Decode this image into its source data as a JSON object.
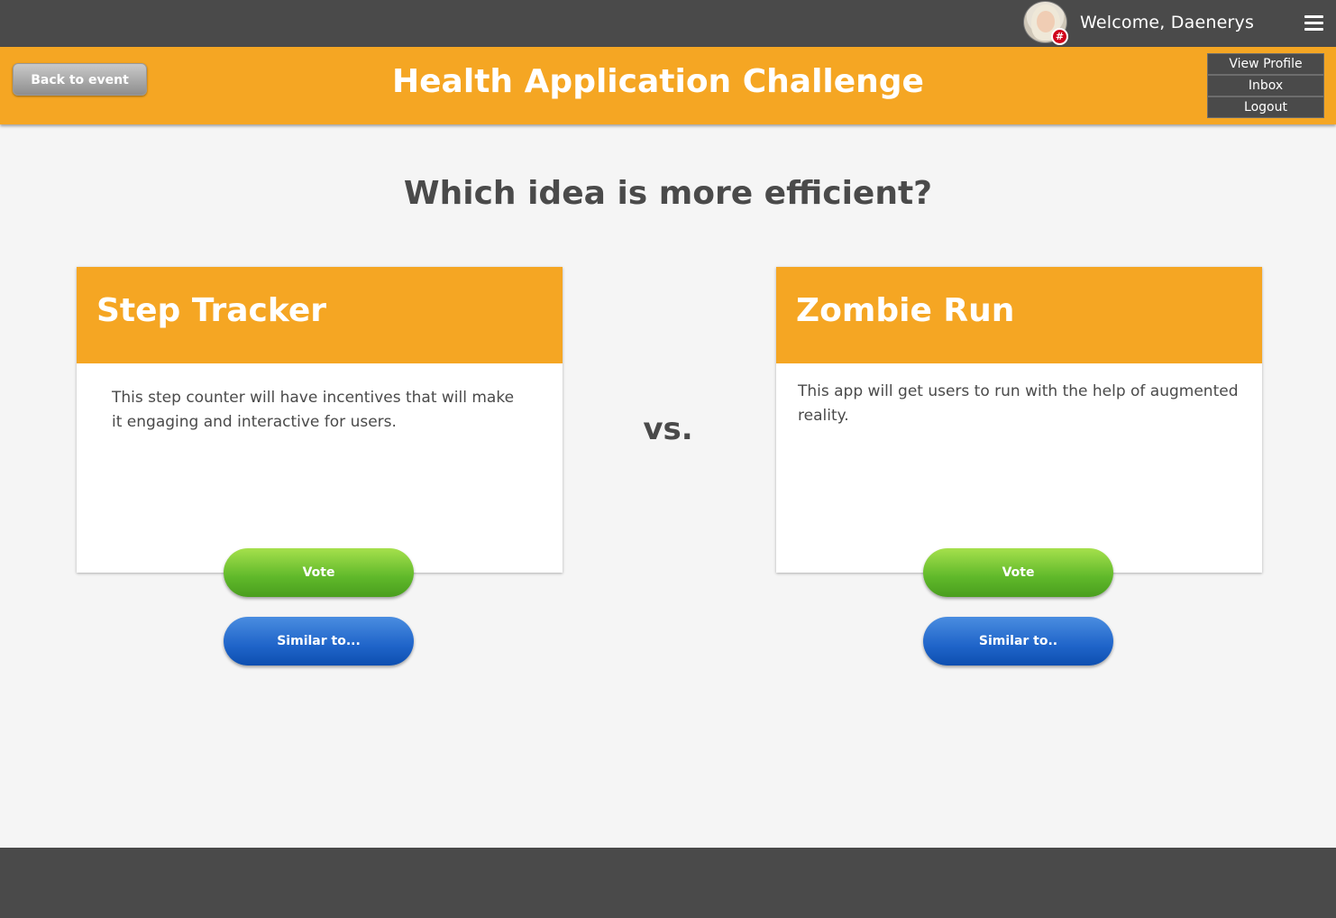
{
  "topbar": {
    "welcome": "Welcome, Daenerys",
    "badge": "#",
    "menu_icon": "hamburger-icon"
  },
  "header": {
    "back_label": "Back to event",
    "title": "Health Application Challenge",
    "dropdown": [
      "View Profile",
      "Inbox",
      "Logout"
    ]
  },
  "main": {
    "question": "Which idea is more efficient?",
    "vs": "vs.",
    "ideas": [
      {
        "title": "Step Tracker",
        "description": "This step counter will have incentives that will make it engaging and interactive for users.",
        "vote_label": "Vote",
        "similar_label": "Similar to..."
      },
      {
        "title": "Zombie Run",
        "description": "This app will get users to run with the help of augmented reality.",
        "vote_label": "Vote",
        "similar_label": "Similar to.."
      }
    ]
  },
  "colors": {
    "accent": "#f5a623",
    "dark": "#4a4a4a",
    "vote_green": "#5fb82a",
    "similar_blue": "#1f64c9"
  }
}
